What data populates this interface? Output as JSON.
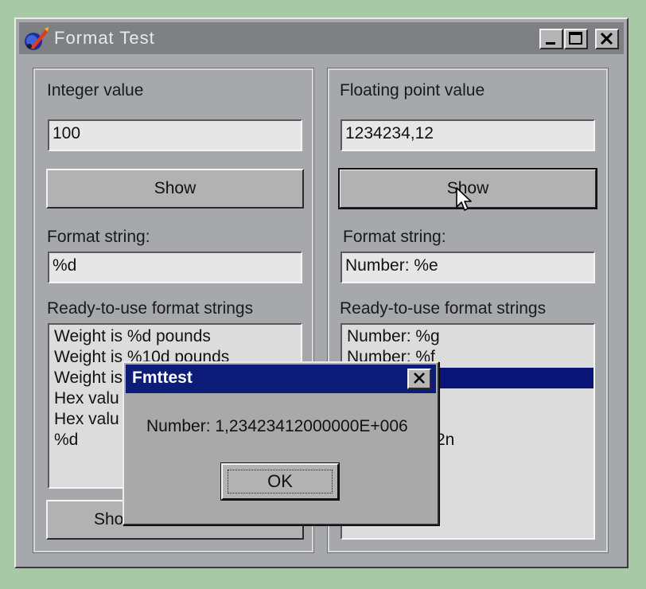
{
  "window": {
    "title": "Format Test",
    "controls": [
      "minimize-icon",
      "maximize-icon",
      "close-icon"
    ]
  },
  "left": {
    "value_label": "Integer value",
    "value": "100",
    "show_label": "Show",
    "format_label": "Format string:",
    "format_value": "%d",
    "list_label": "Ready-to-use format strings",
    "list_items": [
      "Weight is %d pounds",
      "Weight is %10d pounds",
      "Weight is %",
      "Hex valu",
      "Hex valu",
      "%d"
    ],
    "bottom_button_label": "Show"
  },
  "right": {
    "value_label": "Floating point value",
    "value": "1234234,12",
    "show_label": "Show",
    "format_label": "Format string:",
    "format_value": "Number: %e",
    "list_label": "Ready-to-use format strings",
    "list_items": [
      "Number: %g",
      "Number: %f",
      "",
      "",
      "",
      "2n"
    ],
    "selected_index": 2
  },
  "dialog": {
    "title": "Fmttest",
    "message": "Number: 1,23423412000000E+006",
    "ok_label": "OK"
  },
  "colors": {
    "desktop": "#a8c9a5",
    "dialog_title": "#0d1b79",
    "selection": "#0a1578"
  }
}
